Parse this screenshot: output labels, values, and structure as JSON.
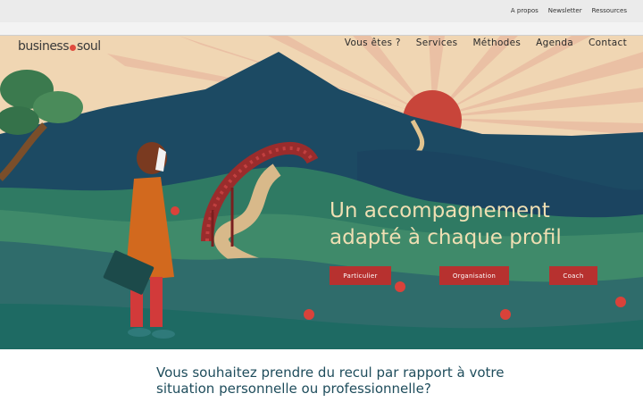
{
  "utility_nav": [
    {
      "label": "A propos"
    },
    {
      "label": "Newsletter"
    },
    {
      "label": "Ressources"
    }
  ],
  "logo": {
    "part1": "business",
    "part2": "soul"
  },
  "main_nav": [
    {
      "label": "Vous êtes ?"
    },
    {
      "label": "Services"
    },
    {
      "label": "Méthodes"
    },
    {
      "label": "Agenda"
    },
    {
      "label": "Contact"
    }
  ],
  "hero": {
    "headline_line1": "Un accompagnement",
    "headline_line2": "adapté à chaque profil",
    "buttons": [
      {
        "label": "Particulier"
      },
      {
        "label": "Organisation"
      },
      {
        "label": "Coach"
      }
    ]
  },
  "intro": {
    "line1": "Vous souhaitez prendre du recul par rapport à votre",
    "line2": "situation personnelle ou professionnelle?"
  },
  "colors": {
    "sky": "#f0d6b3",
    "mountain": "#1c4a63",
    "sun": "#c8453a",
    "hill_green": "#2f7a63",
    "teal": "#2f6c6b",
    "button": "#b7312f",
    "headline": "#efdfb3",
    "intro_text": "#1f4d5c"
  }
}
